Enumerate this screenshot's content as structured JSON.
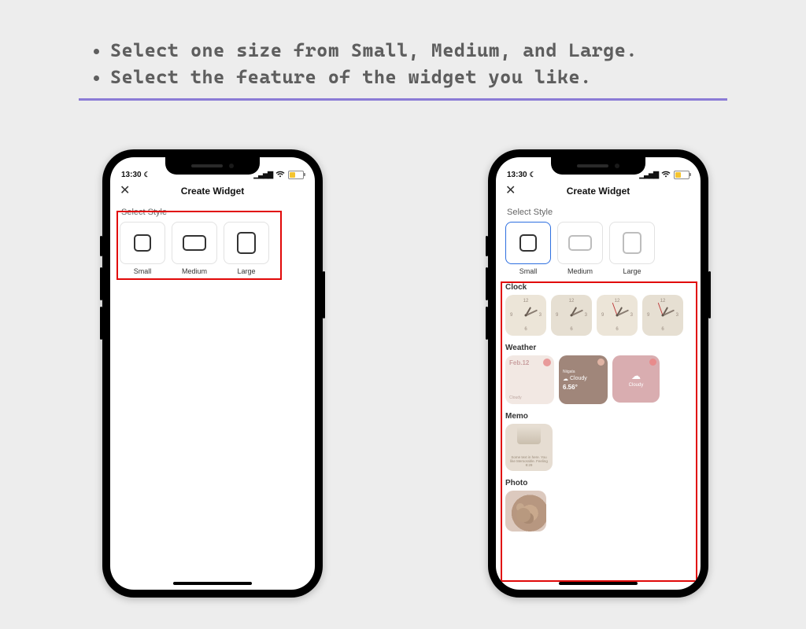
{
  "instructions": {
    "line1": "Select one size from Small, Medium, and Large.",
    "line2": "Select the feature of the widget you like."
  },
  "status": {
    "time": "13:30",
    "dnd": true
  },
  "navbar": {
    "title": "Create Widget",
    "close_glyph": "✕"
  },
  "style": {
    "section_label": "Select Style",
    "sizes": [
      {
        "key": "small",
        "label": "Small"
      },
      {
        "key": "medium",
        "label": "Medium"
      },
      {
        "key": "large",
        "label": "Large"
      }
    ],
    "selected_right": "small"
  },
  "features": {
    "clock": {
      "title": "Clock"
    },
    "weather": {
      "title": "Weather",
      "tiles": [
        {
          "date": "Feb.12",
          "cond": "Cloudy"
        },
        {
          "city": "Niigata",
          "cond": "Cloudy",
          "temp": "6.56°"
        },
        {
          "cond": "Cloudy"
        }
      ]
    },
    "memo": {
      "title": "Memo",
      "text": "Some text in here. You like Memorable. Feeling 8:29"
    },
    "photo": {
      "title": "Photo"
    }
  },
  "clock_face": {
    "n12": "12",
    "n3": "3",
    "n6": "6",
    "n9": "9"
  },
  "glyphs": {
    "moon": "☾",
    "cloud": "☁"
  }
}
